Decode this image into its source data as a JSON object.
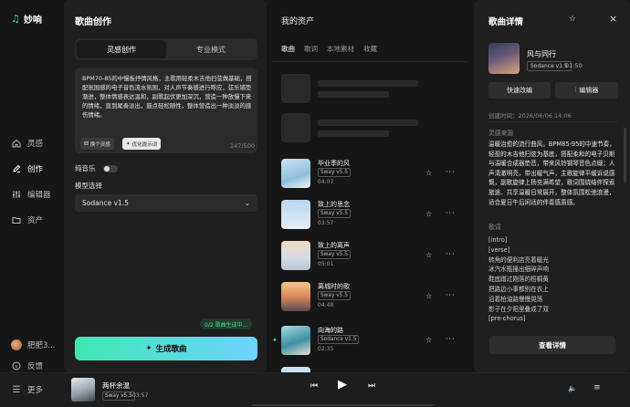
{
  "app": {
    "name": "妙响",
    "logo_icon": "music-note-icon",
    "accent": "#3fe0a3"
  },
  "nav": {
    "items": [
      {
        "label": "灵感",
        "icon": "home-icon"
      },
      {
        "label": "创作",
        "icon": "pen-icon"
      },
      {
        "label": "编辑器",
        "icon": "sliders-icon"
      },
      {
        "label": "资产",
        "icon": "folder-icon"
      }
    ],
    "user": "肥肥3...",
    "feedback": "反馈",
    "more": "更多"
  },
  "create": {
    "title": "歌曲创作",
    "tabs": [
      "灵感创作",
      "专业模式"
    ],
    "prompt": "BPM70-85的中慢板抒情风格，主歌用轻柔木吉他扫弦做基础，搭配氛围感的电子音色流水氛围，对人声节奏感进行呼应，弦乐铺垫渐进，整体情感表达温和，副歌起伏更加深沉，营造一种放慢下来的情绪，直到尾奏淡出，鼓点轻松随性，整体营造出一种淡淡的感伤情绪。",
    "chip_random": "换个灵感",
    "chip_optimize": "优化提示词",
    "counter": "147/500",
    "pure_music": "纯音乐",
    "model_label": "模型选择",
    "model_value": "Sodance v1.5",
    "queue_text": "0/2 歌曲生成中...",
    "generate": "生成歌曲"
  },
  "assets": {
    "title": "我的资产",
    "tabs": [
      "歌曲",
      "歌词",
      "本地素材",
      "收藏"
    ],
    "tracks": [
      {
        "name": "毕业季的风",
        "badge": "Sway v5.5",
        "duration": "04:07"
      },
      {
        "name": "致上的思念",
        "badge": "Sway v5.5",
        "duration": "03:57"
      },
      {
        "name": "致上的离声",
        "badge": "Sway v5.5",
        "duration": "05:01"
      },
      {
        "name": "离城时的歌",
        "badge": "Sway v5.5",
        "duration": "04:48"
      },
      {
        "name": "向海的路",
        "badge": "Sodance v1.5",
        "duration": "02:35"
      }
    ]
  },
  "details": {
    "title": "歌曲详情",
    "name": "风与同行",
    "badge": "Sodance v1.5",
    "duration": "01:50",
    "btn_edit": "快速改编",
    "btn_editor": "编辑器",
    "created": "创建时间：2026/06/06 14:06",
    "insp_label": "灵感来源",
    "inspiration": "温暖治愈的流行曲风，BPM85-95的中速节奏，轻盈的木吉他扫弦为基底，搭配柔和的电子贝斯与温暖合成器垫音，带来风铃钢琴音色点缀；人声清澈明亮，带出暖气声，主歌旋律平缓诉说感慨，副歌旋律上扬充满希望，歌词围绕结伴探索旅途、共享温暖日常展开，整体氛围松弛浪漫，适合夏日午后闲适的伴奏感质感。",
    "lyrics_label": "歌词",
    "lyrics": [
      "[intro]",
      "[verse]",
      "转角的便利店亮着暖光",
      "冰汽水瓶撞出细碎声响",
      "鞋底蹭过刚落的梧桐黄",
      "把路边小事都别在衣上",
      "沿着柏油路慢慢晃荡",
      "影子在夕阳里叠成了双",
      "[pre-chorus]"
    ],
    "view_all": "查看详情"
  },
  "player": {
    "name": "两杯余温",
    "badge": "Sway v5.5",
    "time": "03:57"
  }
}
